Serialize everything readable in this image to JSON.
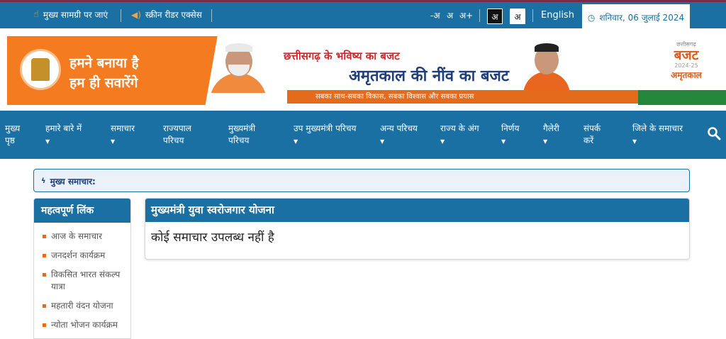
{
  "topbar": {
    "skip_main": "मुख्य सामग्री पर जाएं",
    "screen_reader": "स्क्रीन रीडर एक्सेस",
    "font_decrease": "-अ",
    "font_normal": "अ",
    "font_increase": "अ+",
    "theme_dark": "अ",
    "theme_light": "अ",
    "language": "English",
    "date": "शनिवार, 06 जुलाई 2024"
  },
  "banner": {
    "slogan_line1": "हमने बनाया है",
    "slogan_line2": "हम ही सवारेंगे",
    "headline_1": "छत्तीसगढ़ के भविष्य का बजट",
    "headline_2": "अमृतकाल की नींव का बजट",
    "strip_text": "सबका साथ-सबका विकास, सबका विश्वास और सबका प्रयास",
    "badge_top": "छत्तीसगढ़",
    "badge_main": "बजट",
    "badge_year": "2024-25",
    "badge_sub": "अमृतकाल"
  },
  "nav": {
    "items": [
      {
        "label": "मुख्य पृष्ठ"
      },
      {
        "label": "हमारे बारे में"
      },
      {
        "label": "समाचार"
      },
      {
        "label": "राज्यपाल परिचय"
      },
      {
        "label": "मुख्यमंत्री परिचय"
      },
      {
        "label": "उप मुख्यमंत्री परिचय"
      },
      {
        "label": "अन्य परिचय"
      },
      {
        "label": "राज्य के अंग"
      },
      {
        "label": "निर्णय"
      },
      {
        "label": "गैलेरी"
      },
      {
        "label": "संपर्क करें"
      },
      {
        "label": "जिले के समाचार"
      }
    ]
  },
  "ticker": {
    "label": "मुख्य समाचार:"
  },
  "sidebar": {
    "title": "महत्वपूर्ण लिंक",
    "items": [
      {
        "label": "आज के समाचार"
      },
      {
        "label": "जनदर्शन कार्यक्रम"
      },
      {
        "label": "विकसित भारत संकल्प यात्रा"
      },
      {
        "label": "महतारी वंदन योजना"
      },
      {
        "label": "न्योता भोजन कार्यक्रम"
      }
    ]
  },
  "main": {
    "title": "मुख्यमंत्री युवा स्वरोजगार योजना",
    "empty_message": "कोई समाचार उपलब्ध नहीं है"
  },
  "colors": {
    "primary": "#1a6fa3",
    "banner_orange": "#f47b20",
    "accent_orange": "#e46a1c",
    "navy": "#1f3f7a"
  }
}
